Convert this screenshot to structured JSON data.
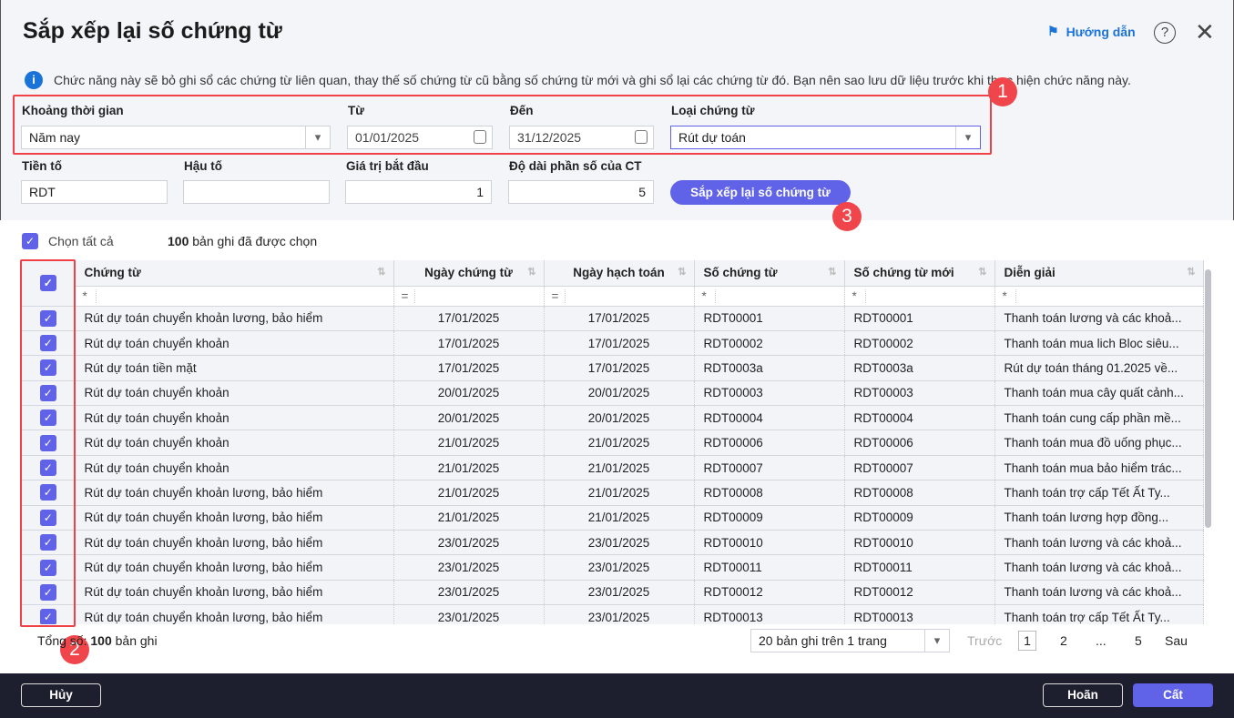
{
  "title": "Sắp xếp lại số chứng từ",
  "guide": "Hướng dẫn",
  "info": "Chức năng này sẽ bỏ ghi sổ các chứng từ liên quan, thay thế số chứng từ cũ bằng số chứng từ mới và ghi sổ lại các chứng từ đó. Bạn nên sao lưu dữ liệu trước khi thực hiện chức năng này.",
  "filters": {
    "period_label": "Khoảng thời gian",
    "period": "Năm nay",
    "from_label": "Từ",
    "from": "01/01/2025",
    "to_label": "Đến",
    "to": "31/12/2025",
    "type_label": "Loại chứng từ",
    "type": "Rút dự toán",
    "prefix_label": "Tiền tố",
    "prefix": "RDT",
    "suffix_label": "Hậu tố",
    "suffix": "",
    "start_label": "Giá trị bắt đầu",
    "start": "1",
    "length_label": "Độ dài phần số của CT",
    "length": "5"
  },
  "sort_button": "Sắp xếp lại số chứng từ",
  "badges": [
    "1",
    "2",
    "3"
  ],
  "select_all": "Chọn tất cả",
  "selected_count": "100",
  "selected_text": "bản ghi đã được chọn",
  "columns": [
    "Chứng từ",
    "Ngày chứng từ",
    "Ngày hạch toán",
    "Số chứng từ",
    "Số chứng từ mới",
    "Diễn giải"
  ],
  "filter_ops": [
    "*",
    "=",
    "=",
    "*",
    "*",
    "*"
  ],
  "rows": [
    [
      "Rút dự toán chuyển khoản lương, bảo hiểm",
      "17/01/2025",
      "17/01/2025",
      "RDT00001",
      "RDT00001",
      "Thanh toán lương và các khoả..."
    ],
    [
      "Rút dự toán chuyển khoản",
      "17/01/2025",
      "17/01/2025",
      "RDT00002",
      "RDT00002",
      "Thanh toán mua lich Bloc siêu..."
    ],
    [
      "Rút dự toán tiền mặt",
      "17/01/2025",
      "17/01/2025",
      "RDT0003a",
      "RDT0003a",
      "Rút dự toán tháng 01.2025 về..."
    ],
    [
      "Rút dự toán chuyển khoản",
      "20/01/2025",
      "20/01/2025",
      "RDT00003",
      "RDT00003",
      "Thanh toán mua cây quất cảnh..."
    ],
    [
      "Rút dự toán chuyển khoản",
      "20/01/2025",
      "20/01/2025",
      "RDT00004",
      "RDT00004",
      "Thanh toán cung cấp phần mề..."
    ],
    [
      "Rút dự toán chuyển khoản",
      "21/01/2025",
      "21/01/2025",
      "RDT00006",
      "RDT00006",
      "Thanh toán mua đồ uống phục..."
    ],
    [
      "Rút dự toán chuyển khoản",
      "21/01/2025",
      "21/01/2025",
      "RDT00007",
      "RDT00007",
      "Thanh toán mua bảo hiểm trác..."
    ],
    [
      "Rút dự toán chuyển khoản lương, bảo hiểm",
      "21/01/2025",
      "21/01/2025",
      "RDT00008",
      "RDT00008",
      "Thanh toán trợ cấp Tết Ất Ty..."
    ],
    [
      "Rút dự toán chuyển khoản lương, bảo hiểm",
      "21/01/2025",
      "21/01/2025",
      "RDT00009",
      "RDT00009",
      "Thanh toán lương hợp đồng..."
    ],
    [
      "Rút dự toán chuyển khoản lương, bảo hiểm",
      "23/01/2025",
      "23/01/2025",
      "RDT00010",
      "RDT00010",
      "Thanh toán lương và các khoả..."
    ],
    [
      "Rút dự toán chuyển khoản lương, bảo hiểm",
      "23/01/2025",
      "23/01/2025",
      "RDT00011",
      "RDT00011",
      "Thanh toán lương và các khoả..."
    ],
    [
      "Rút dự toán chuyển khoản lương, bảo hiểm",
      "23/01/2025",
      "23/01/2025",
      "RDT00012",
      "RDT00012",
      "Thanh toán lương và các khoả..."
    ],
    [
      "Rút dự toán chuyển khoản lương, bảo hiểm",
      "23/01/2025",
      "23/01/2025",
      "RDT00013",
      "RDT00013",
      "Thanh toán trợ cấp Tết Ất Ty..."
    ]
  ],
  "total_prefix": "Tổng số:",
  "total": "100",
  "total_suffix": "bản ghi",
  "page_size": "20 bản ghi trên 1 trang",
  "pager": {
    "prev": "Trước",
    "pages": [
      "1",
      "2",
      "...",
      "5"
    ],
    "next": "Sau"
  },
  "footer": {
    "cancel": "Hủy",
    "undo": "Hoãn",
    "save": "Cất"
  },
  "colors": {
    "accent": "#6062e8",
    "badge": "#f0454a",
    "link": "#1a73d9"
  }
}
